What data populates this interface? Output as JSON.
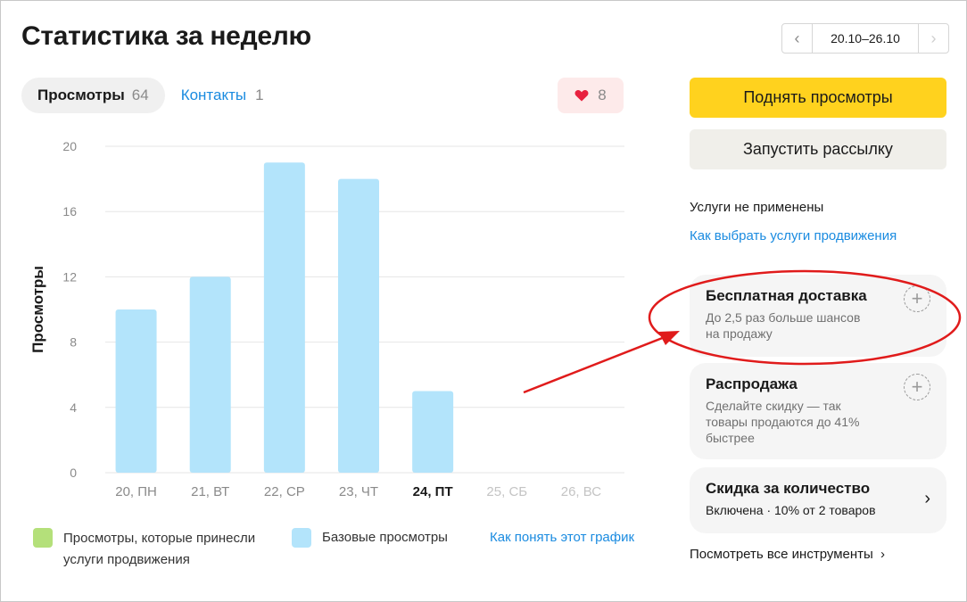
{
  "page": {
    "title": "Статистика за неделю"
  },
  "date_range": {
    "prev_icon": "chevron-left-icon",
    "label": "20.10–26.10",
    "next_icon": "chevron-right-icon"
  },
  "tabs": [
    {
      "label": "Просмотры",
      "count": "64",
      "active": true
    },
    {
      "label": "Контакты",
      "count": "1",
      "active": false
    }
  ],
  "favorites": {
    "icon": "heart-icon",
    "count": "8",
    "color": "#e8213f"
  },
  "chart_data": {
    "type": "bar",
    "categories": [
      "20, ПН",
      "21, ВТ",
      "22, СР",
      "23, ЧТ",
      "24, ПТ",
      "25, СБ",
      "26, ВС"
    ],
    "category_states": [
      "past",
      "past",
      "past",
      "past",
      "today",
      "future",
      "future"
    ],
    "series": [
      {
        "name": "Базовые просмотры",
        "values": [
          10,
          12,
          19,
          18,
          5,
          0,
          0
        ],
        "color": "#b3e4fb"
      },
      {
        "name": "Просмотры, которые принесли услуги продвижения",
        "values": [
          0,
          0,
          0,
          0,
          0,
          0,
          0
        ],
        "color": "#b4e07a"
      }
    ],
    "ylabel": "Просмотры",
    "yticks": [
      0,
      4,
      8,
      12,
      16,
      20
    ],
    "ylim": [
      0,
      20
    ],
    "grid": true
  },
  "legend": {
    "promo": {
      "label_line1": "Просмотры, которые принесли",
      "label_line2": "услуги продвижения",
      "color": "#b4e07a"
    },
    "base": {
      "label": "Базовые просмотры",
      "color": "#b3e4fb"
    },
    "help_link": "Как понять этот график"
  },
  "actions": {
    "raise_views": "Поднять просмотры",
    "start_mailing": "Запустить рассылку"
  },
  "services": {
    "status": "Услуги не применены",
    "howto_link": "Как выбрать услуги продвижения",
    "cards": [
      {
        "title": "Бесплатная доставка",
        "desc_line1": "До 2,5 раз больше шансов",
        "desc_line2": "на продажу"
      },
      {
        "title": "Распродажа",
        "desc_line1": "Сделайте скидку — так",
        "desc_line2": "товары продаются до 41%",
        "desc_line3": "быстрее"
      },
      {
        "title": "Скидка за количество",
        "desc_line1": "Включена · 10% от 2 товаров"
      }
    ],
    "all_tools": "Посмотреть все инструменты"
  },
  "annotation": {
    "color": "#e01b1b"
  }
}
